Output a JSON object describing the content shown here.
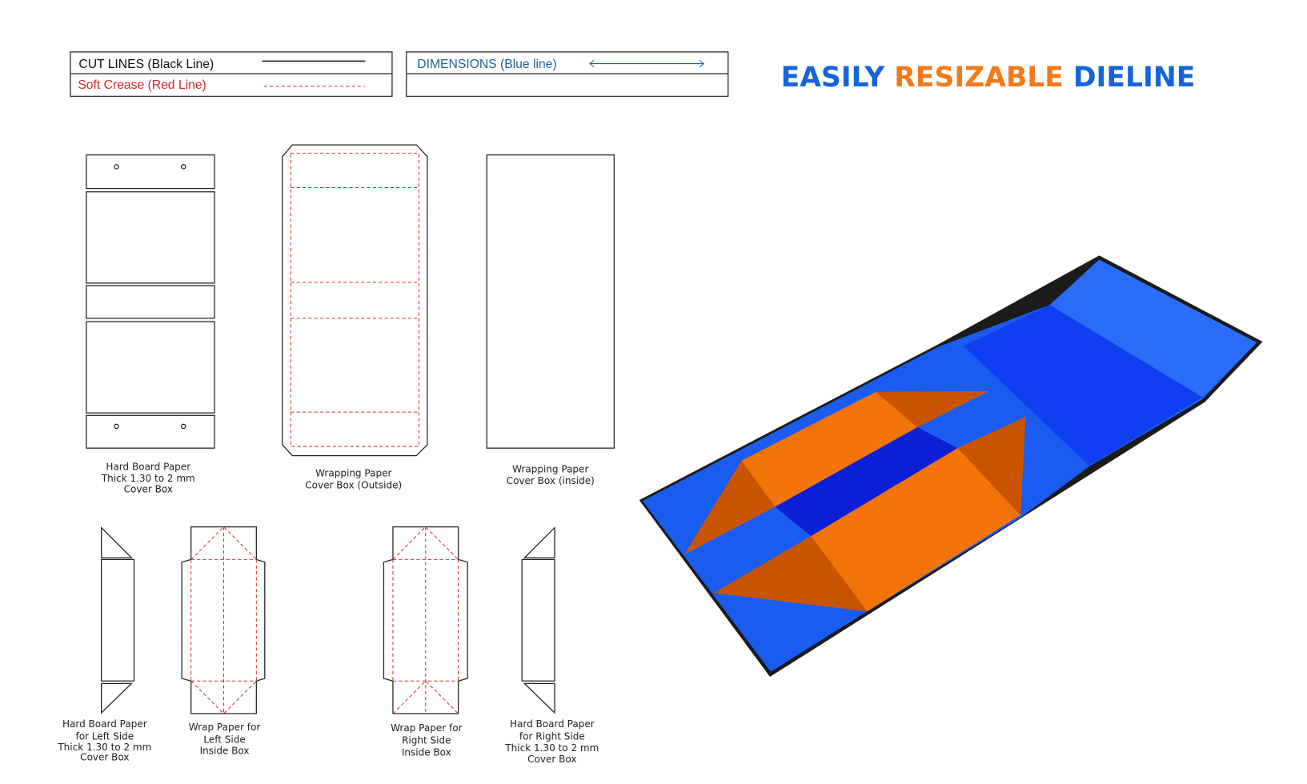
{
  "legend": {
    "cut_lines": "CUT LINES (Black Line)",
    "soft_crease": "Soft Crease (Red Line)",
    "dimensions": "DIMENSIONS (Blue line)"
  },
  "title": {
    "part1": "EASILY",
    "part2": "RESIZABLE",
    "part3": "DIELINE",
    "color_blue": "#1565d8",
    "color_orange": "#f07a1a"
  },
  "labels": {
    "hard_board_cover": [
      "Hard Board Paper",
      "Thick 1.30 to 2 mm",
      "Cover Box"
    ],
    "wrap_outside": [
      "Wrapping Paper",
      "Cover Box (Outside)"
    ],
    "wrap_inside": [
      "Wrapping Paper",
      "Cover Box (inside)"
    ],
    "hard_board_left": [
      "Hard Board Paper",
      "for Left Side",
      "Thick 1.30 to 2 mm",
      "Cover Box"
    ],
    "wrap_left": [
      "Wrap Paper for",
      "Left Side",
      "Inside Box"
    ],
    "wrap_right": [
      "Wrap Paper for",
      "Right Side",
      "Inside Box"
    ],
    "hard_board_right": [
      "Hard Board Paper",
      "for Right Side",
      "Thick 1.30 to 2 mm",
      "Cover Box"
    ]
  },
  "colors": {
    "cut": "#222222",
    "crease": "#d9302b",
    "dimension": "#1f5f9e",
    "box_blue": "#1a5cf0",
    "box_orange": "#f27306"
  }
}
